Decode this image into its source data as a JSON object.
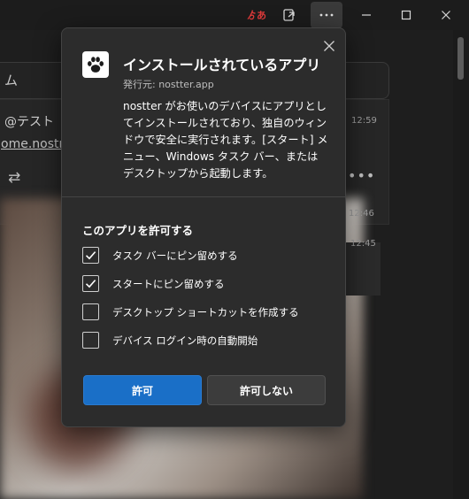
{
  "titlebar": {
    "ime_indicator": "ゟあ",
    "buttons": [
      "app-install-icon",
      "more-icon",
      "minimize-icon",
      "maximize-icon",
      "close-icon"
    ]
  },
  "background": {
    "search_text": "ム",
    "post_handle": "@テスト",
    "post_link": "ome.nostr-",
    "times": [
      "12:59",
      "12:46",
      "12:45"
    ]
  },
  "dialog": {
    "title": "インストールされているアプリ",
    "publisher": "発行元: nostter.app",
    "description": "nostter がお使いのデバイスにアプリとしてインストールされており、独自のウィンドウで安全に実行されます。[スタート] メニュー、Windows タスク バー、またはデスクトップから起動します。",
    "permissions_title": "このアプリを許可する",
    "permissions": [
      {
        "label": "タスク バーにピン留めする",
        "checked": true
      },
      {
        "label": "スタートにピン留めする",
        "checked": true
      },
      {
        "label": "デスクトップ ショートカットを作成する",
        "checked": false
      },
      {
        "label": "デバイス ログイン時の自動開始",
        "checked": false
      }
    ],
    "allow_label": "許可",
    "deny_label": "許可しない"
  },
  "colors": {
    "accent": "#1a6fc7",
    "dialog_bg": "#2c2c2c",
    "page_bg": "#1e1e1e"
  }
}
